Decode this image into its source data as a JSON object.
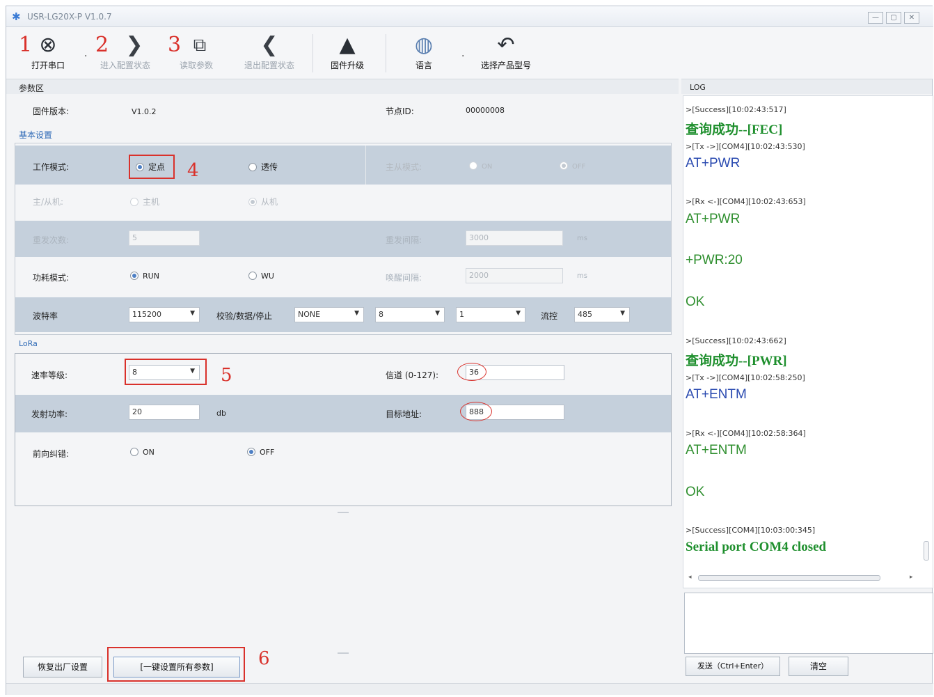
{
  "window": {
    "title": "USR-LG20X-P  V1.0.7"
  },
  "toolbar": {
    "open_port": "打开串口",
    "enter_config": "进入配置状态",
    "read_params": "读取参数",
    "exit_config": "退出配置状态",
    "firmware": "固件升级",
    "language": "语言",
    "select_model": "选择产品型号",
    "markers": [
      "1",
      "2",
      "3"
    ]
  },
  "param_area": {
    "title": "参数区",
    "firmware_label": "固件版本:",
    "firmware_value": "V1.0.2",
    "node_label": "节点ID:",
    "node_value": "00000008",
    "basic_title": "基本设置",
    "work_mode_label": "工作模式:",
    "work_mode_fixed": "定点",
    "work_mode_trans": "透传",
    "master_slave_mode_label": "主从模式:",
    "ms_on": "ON",
    "ms_off": "OFF",
    "master_slave_label": "主/从机:",
    "master": "主机",
    "slave": "从机",
    "retry_label": "重发次数:",
    "retry_value": "5",
    "retry_interval_label": "重发间隔:",
    "retry_interval_value": "3000",
    "retry_interval_unit": "ms",
    "power_mode_label": "功耗模式:",
    "run": "RUN",
    "wu": "WU",
    "wake_interval_label": "唤醒间隔:",
    "wake_interval_value": "2000",
    "wake_interval_unit": "ms",
    "baud_label": "波特率",
    "baud_value": "115200",
    "parity_label": "校验/数据/停止",
    "parity_value": "NONE",
    "data_bits": "8",
    "stop_bits": "1",
    "flow_label": "流控",
    "flow_value": "485",
    "marker4": "4"
  },
  "lora": {
    "title": "LoRa",
    "speed_label": "速率等级:",
    "speed_value": "8",
    "channel_label": "信道 (0-127):",
    "channel_value": "36",
    "tx_power_label": "发射功率:",
    "tx_power_value": "20",
    "tx_power_unit": "db",
    "target_label": "目标地址:",
    "target_value": "888",
    "fec_label": "前向纠错:",
    "fec_on": "ON",
    "fec_off": "OFF",
    "marker5": "5"
  },
  "bottom": {
    "factory_reset": "恢复出厂设置",
    "set_all": "[一键设置所有参数]",
    "marker6": "6"
  },
  "log": {
    "title": "LOG",
    "lines": [
      ">[Success][10:02:43:517]",
      "查询成功--[FEC]",
      ">[Tx ->][COM4][10:02:43:530]",
      "AT+PWR",
      ">[Rx <-][COM4][10:02:43:653]",
      "AT+PWR",
      "+PWR:20",
      "OK",
      ">[Success][10:02:43:662]",
      "查询成功--[PWR]",
      ">[Tx ->][COM4][10:02:58:250]",
      "AT+ENTM",
      ">[Rx <-][COM4][10:02:58:364]",
      "AT+ENTM",
      "OK",
      ">[Success][COM4][10:03:00:345]",
      "Serial port COM4 closed"
    ],
    "send_btn": "发送（Ctrl+Enter）",
    "clear_btn": "清空"
  }
}
